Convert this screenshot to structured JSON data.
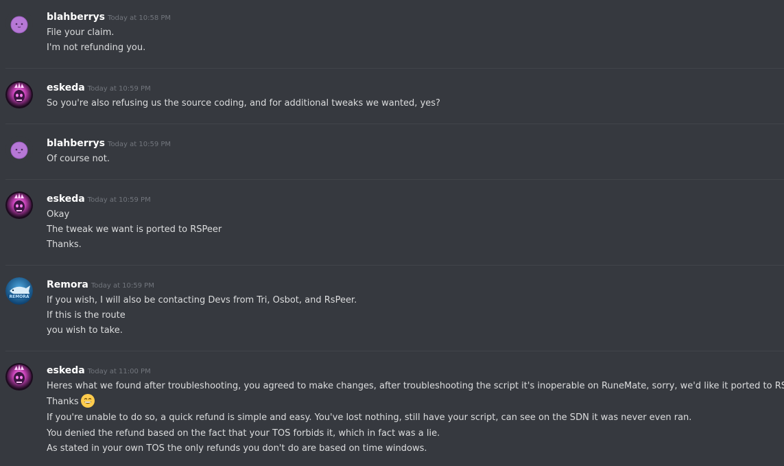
{
  "messages": [
    {
      "username": "blahberrys",
      "timestamp": "Today at 10:58 PM",
      "avatar_icon": "purple-blob-avatar",
      "lines": [
        "File your claim.",
        "I'm not refunding you."
      ]
    },
    {
      "username": "eskeda",
      "timestamp": "Today at 10:59 PM",
      "avatar_icon": "pink-glow-skull-avatar",
      "lines": [
        "So you're also refusing us the source coding, and for additional tweaks we wanted, yes?"
      ]
    },
    {
      "username": "blahberrys",
      "timestamp": "Today at 10:59 PM",
      "avatar_icon": "purple-blob-avatar",
      "lines": [
        "Of course not."
      ]
    },
    {
      "username": "eskeda",
      "timestamp": "Today at 10:59 PM",
      "avatar_icon": "pink-glow-skull-avatar",
      "lines": [
        "Okay",
        "The tweak we want is ported to RSPeer",
        "Thanks."
      ]
    },
    {
      "username": "Remora",
      "timestamp": "Today at 10:59 PM",
      "avatar_icon": "blue-fish-remora-avatar",
      "avatar_text": "REMORA",
      "lines": [
        "If you wish, I will also be contacting Devs from Tri, Osbot, and RsPeer.",
        "If this is the route",
        "you wish to take."
      ]
    },
    {
      "username": "eskeda",
      "timestamp": "Today at 11:00 PM",
      "avatar_icon": "pink-glow-skull-avatar",
      "lines": [
        "Heres what we found after troubleshooting, you agreed to make changes, after troubleshooting the script it's inoperable on RuneMate, sorry, we'd like it ported to RSPeer",
        "Thanks",
        "If you're unable to do so, a quick refund is simple and easy.  You've lost nothing, still have your script, can see on the SDN it was never even ran.",
        "You denied the refund based on the fact that your TOS forbids it, which in fact was a lie.",
        "As stated in your own TOS the only refunds you don't do are based on time windows."
      ],
      "emoji": "grinning-face-emoji"
    }
  ],
  "colors": {
    "background": "#36393f",
    "username": "#ffffff",
    "timestamp": "#72767d",
    "text": "#dcddde",
    "divider": "#42454a"
  }
}
